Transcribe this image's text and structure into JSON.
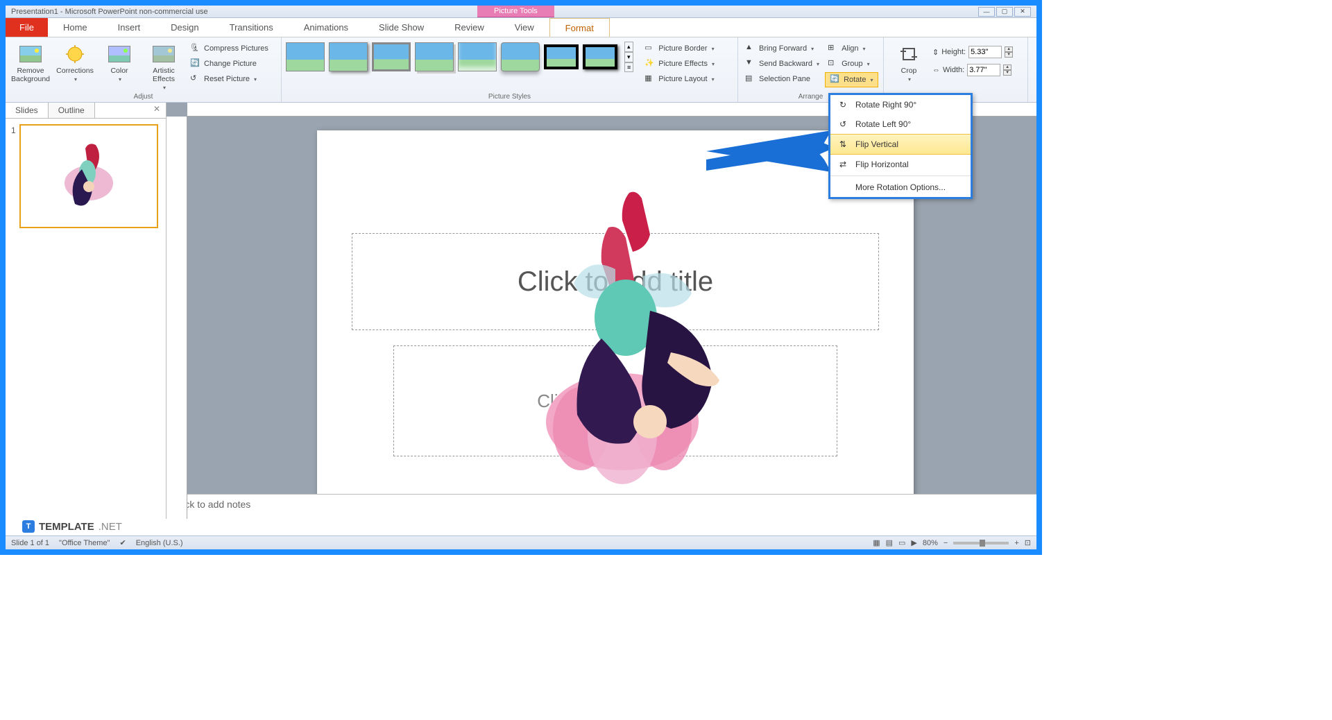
{
  "title_bar": "Presentation1 - Microsoft PowerPoint non-commercial use",
  "context_tab": "Picture Tools",
  "tabs": {
    "file": "File",
    "home": "Home",
    "insert": "Insert",
    "design": "Design",
    "transitions": "Transitions",
    "animations": "Animations",
    "slideshow": "Slide Show",
    "review": "Review",
    "view": "View",
    "format": "Format"
  },
  "ribbon": {
    "adjust": {
      "label": "Adjust",
      "remove_bg": "Remove Background",
      "corrections": "Corrections",
      "color": "Color",
      "artistic": "Artistic Effects",
      "compress": "Compress Pictures",
      "change": "Change Picture",
      "reset": "Reset Picture"
    },
    "styles": {
      "label": "Picture Styles",
      "border": "Picture Border",
      "effects": "Picture Effects",
      "layout": "Picture Layout"
    },
    "arrange": {
      "label": "Arrange",
      "forward": "Bring Forward",
      "backward": "Send Backward",
      "selection": "Selection Pane",
      "align": "Align",
      "group": "Group",
      "rotate": "Rotate"
    },
    "size": {
      "crop": "Crop",
      "height_label": "Height:",
      "height_value": "5.33\"",
      "width_label": "Width:",
      "width_value": "3.77\""
    }
  },
  "rotate_menu": {
    "right": "Rotate Right 90°",
    "left": "Rotate Left 90°",
    "flip_v": "Flip Vertical",
    "flip_h": "Flip Horizontal",
    "more": "More Rotation Options..."
  },
  "side": {
    "slides": "Slides",
    "outline": "Outline",
    "num": "1"
  },
  "placeholders": {
    "title": "Click to add title",
    "subtitle": "Click to add subtitle",
    "notes": "Click to add notes"
  },
  "status": {
    "slide": "Slide 1 of 1",
    "theme": "\"Office Theme\"",
    "lang": "English (U.S.)",
    "zoom": "80%"
  },
  "watermark": {
    "text": "TEMPLATE",
    "net": ".NET"
  }
}
